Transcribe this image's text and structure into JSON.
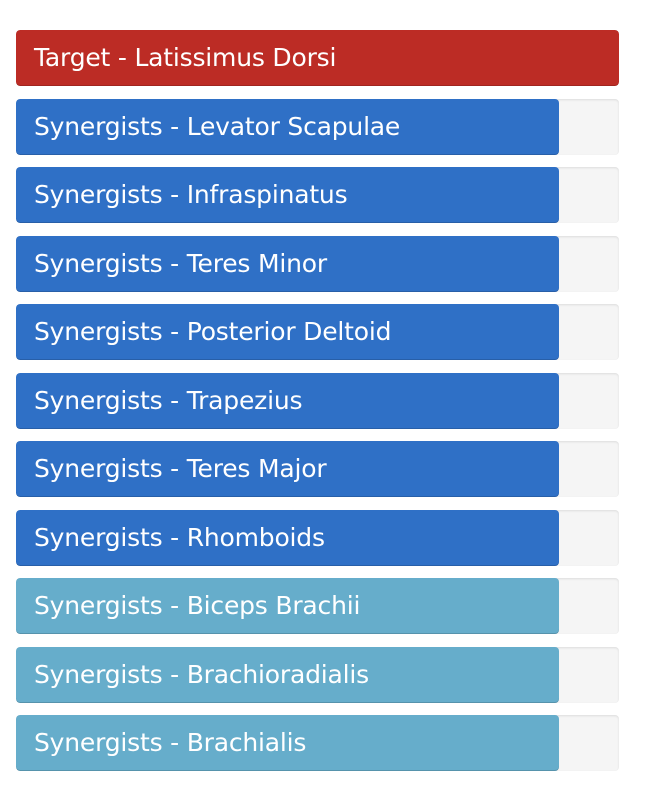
{
  "muscles": [
    {
      "label": "Target - Latissimus Dorsi",
      "level": 100,
      "color": "#bc2c25"
    },
    {
      "label": "Synergists - Levator Scapulae",
      "level": 90,
      "color": "#2f70c6"
    },
    {
      "label": "Synergists - Infraspinatus",
      "level": 90,
      "color": "#2f70c6"
    },
    {
      "label": "Synergists - Teres Minor",
      "level": 90,
      "color": "#2f70c6"
    },
    {
      "label": "Synergists - Posterior Deltoid",
      "level": 90,
      "color": "#2f70c6"
    },
    {
      "label": "Synergists - Trapezius",
      "level": 90,
      "color": "#2f70c6"
    },
    {
      "label": "Synergists - Teres Major",
      "level": 90,
      "color": "#2f70c6"
    },
    {
      "label": "Synergists - Rhomboids",
      "level": 90,
      "color": "#2f70c6"
    },
    {
      "label": "Synergists - Biceps Brachii",
      "level": 90,
      "color": "#66adcb"
    },
    {
      "label": "Synergists - Brachioradialis",
      "level": 90,
      "color": "#66adcb"
    },
    {
      "label": "Synergists - Brachialis",
      "level": 90,
      "color": "#66adcb"
    }
  ]
}
